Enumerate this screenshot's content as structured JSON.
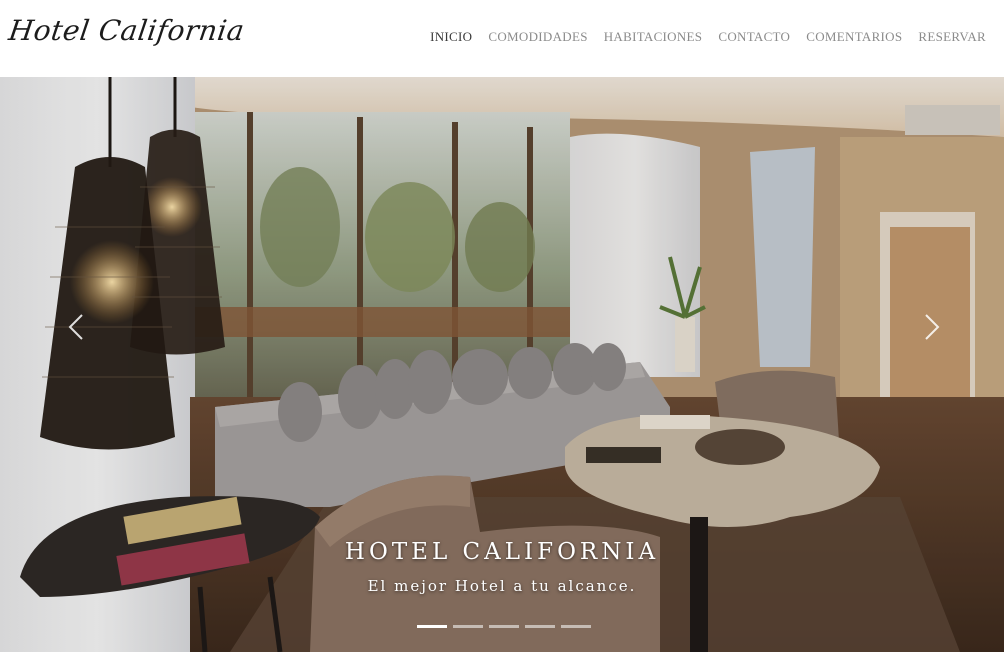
{
  "brand": {
    "name": "Hotel California"
  },
  "nav": {
    "items": [
      {
        "label": "INICIO",
        "active": true
      },
      {
        "label": "COMODIDADES",
        "active": false
      },
      {
        "label": "HABITACIONES",
        "active": false
      },
      {
        "label": "CONTACTO",
        "active": false
      },
      {
        "label": "COMENTARIOS",
        "active": false
      },
      {
        "label": "RESERVAR",
        "active": false
      }
    ]
  },
  "carousel": {
    "title": "HOTEL CALIFORNIA",
    "subtitle": "El mejor Hotel a tu alcance.",
    "slide_count": 5,
    "active_slide": 1,
    "prev_icon": "chevron-left-icon",
    "next_icon": "chevron-right-icon"
  },
  "colors": {
    "nav_text": "#8b8b8b",
    "nav_active": "#3a3a3a",
    "caption_text": "#ffffff"
  }
}
